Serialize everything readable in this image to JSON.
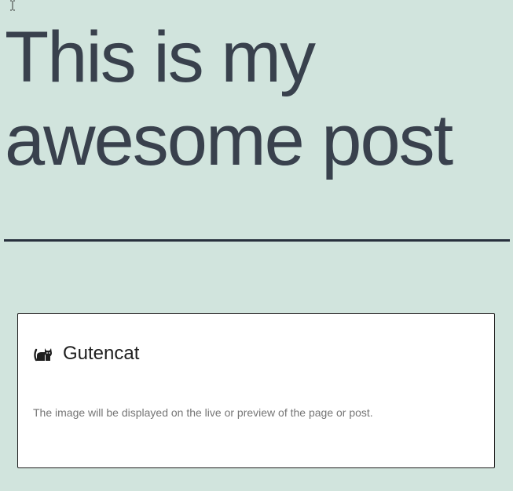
{
  "post": {
    "title": "This is my awesome post"
  },
  "cursor": {
    "icon": "text-cursor-icon"
  },
  "block": {
    "icon": "cat-icon",
    "title": "Gutencat",
    "instructions": "The image will be displayed on the live or preview of the page or post."
  },
  "colors": {
    "background": "#d1e4dd",
    "title": "#39414d",
    "separator": "#28303d",
    "block_border": "#1e1e1e",
    "instructions": "#757575"
  }
}
